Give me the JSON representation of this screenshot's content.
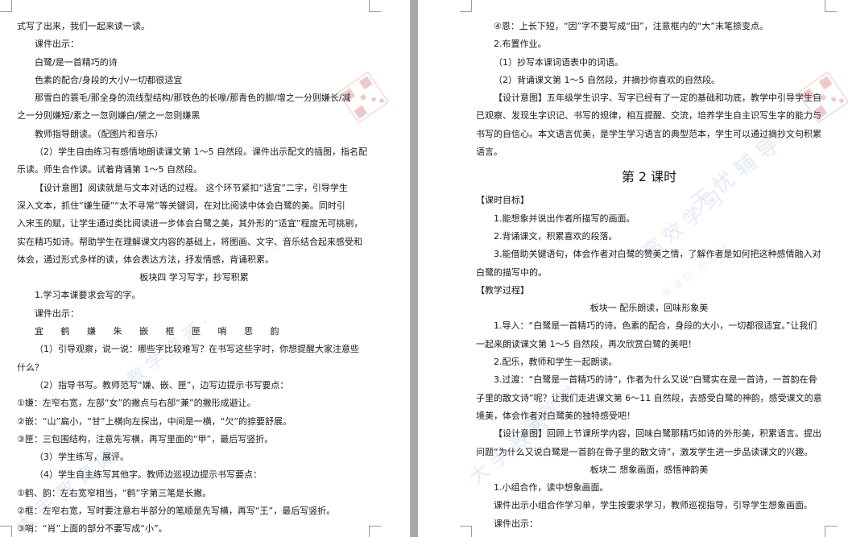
{
  "left_page": {
    "lines": [
      "式写了出来，我们一起来读一读。",
      "课件出示：",
      "白鹭/是一首精巧的诗",
      "色素的配合/身段的大小/一切都很适宜",
      "那雪白的蓑毛/那全身的流线型结构/那铁色的长喙/那青色的脚/增之一分则嫌长/减",
      "之一分则嫌短/素之一忽则嫌白/黛之一忽则嫌黑",
      "教师指导朗读。（配图片和音乐）",
      "（2）学生自由练习有感情地朗读课文第 1～5 自然段。课件出示配文的插图，指名配",
      "乐读。师生合作读。试着背诵第 1～5 自然段。",
      "【设计意图】阅读就是与文本对话的过程。 这个环节紧扣“适宜”二字，引导学生",
      "深入文本，抓住“嫌生硬”“太不寻常”等关键词，在对比阅读中体会白鹭的美。同时引",
      "入宋玉的赋，让学生通过类比阅读进一步体会白鹭之美，其外形的“适宜”程度无可挑剔，",
      "实在精巧如诗。帮助学生在理解课文内容的基础上，将图画、文字、音乐结合起来感受和",
      "体会，通过形式多样的读，体会表达方法，抒发情感，背诵积累。",
      "板块四 学习写字，抄写积累",
      "1.学习本课要求会写的字。",
      "课件出示：",
      "宜 鹤 嫌 朱 嵌 框 匣 哨 思 韵",
      "（1）引导观察，说一说：哪些字比较难写？在书写这些字时，你想提醒大家注意些",
      "什么？",
      "（2）指导书写。教师范写“嫌、嵌、匣”，边写边提示书写要点：",
      "①嫌：左窄右宽，左部“女”的撇点与右部“兼”的撇形成避让。",
      "②嵌：“山”扁小，“甘”上横向左探出，中间是一横，“欠”的捺要舒展。",
      "③匣：三包围结构，注意先写横，再写里面的“甲”，最后写竖折。",
      "（3）学生练写，展评。",
      "（4）学生自主练写其他字。教师边巡视边提示书写要点：",
      "①鹤、韵：左右宽窄相当，“鹤”字第三笔是长撇。",
      "②框：左窄右宽，写时要注意右半部分的笔顺是先写横，再写“王”，最后写竖折。",
      "③哨：“肖”上面的部分不要写成“小”。"
    ]
  },
  "right_page": {
    "lines": [
      "④恩：上长下短，“因”字不要写成“田”，注意框内的“大”末笔捺变点。",
      "2.布置作业。",
      "（1）抄写本课词语表中的词语。",
      "（2）背诵课文第 1～5 自然段，并摘抄你喜欢的自然段。",
      "【设计意图】五年级学生识字、写字已经有了一定的基础和功底，教学中引导学生自",
      "已观察、发现生字识记、书写的规律，相互提醒、交流，培养学生自主识写生字的能力与",
      "书写的自信心。本文语言优美，是学生学习语言的典型范本，学生可以通过摘抄文句积累",
      "语言。",
      "第 2 课时",
      "【课时目标】",
      "1.能想象并说出作者所描写的画面。",
      "2.背诵课文，积累喜欢的段落。",
      "3.能借助关键语句，体会作者对白鹭的赞美之情，了解作者是如何把这种感情融入对",
      "白鹭的描写中的。",
      "【教学过程】",
      "板块一 配乐朗读，回味形象美",
      "1.导入：“白鹭是一首精巧的诗。色素的配合，身段的大小，一切都很适宜。”让我们",
      "一起来朗读课文第 1～5 自然段，再次欣赏白鹭的美吧！",
      "2.配乐，教师和学生一起朗读。",
      "3.过渡：“白鹭是一首精巧的诗”，作者为什么又说“白鹭实在是一首诗，一首韵在骨",
      "子里的散文诗”呢？让我们走进课文第 6～11 自然段，去感受白鹭的神韵，感受课文的意",
      "境美，体会作者对白鹭美的独特感受吧！",
      "【设计意图】回顾上节课所学内容，回味白鹭那精巧如诗的外形美，积累语言。提出",
      "问题“为什么又说白鹭是一首韵在骨子里的散文诗”，激发学生进一步品读课文的兴趣。",
      "板块二 想象画面，感悟神韵美",
      "1.小组合作，读中想象画面。",
      "课件出示小组合作学习单，学生按要求学习，教师巡视指导，引导学生想象画面。",
      "课件出示："
    ]
  },
  "watermarks": {
    "left_bottom": "大 手 教 育 网",
    "left_center": "教 学 资 源 ·",
    "left_faint": "中 国 教 育 资 源 网",
    "right_top": "高 效 学 习",
    "right_brand": "无 忧 辅 导",
    "right_faint": "新 课 标 · 新 教 材",
    "right_bottom": "大 手 教 育",
    "right_center": "高 效 学 习"
  },
  "colors": {
    "background": "#a9a9a9",
    "page": "#ffffff",
    "text": "#1a1a1a",
    "watermark": "#5078c8"
  }
}
